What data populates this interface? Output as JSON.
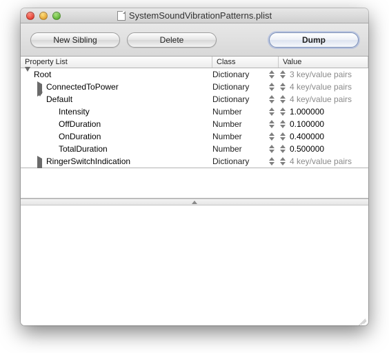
{
  "window": {
    "title": "SystemSoundVibrationPatterns.plist"
  },
  "toolbar": {
    "new_sibling_label": "New Sibling",
    "delete_label": "Delete",
    "dump_label": "Dump"
  },
  "headers": {
    "property": "Property List",
    "class": "Class",
    "value": "Value"
  },
  "rows": [
    {
      "indent": 0,
      "disclosure": "down",
      "name": "Root",
      "class": "Dictionary",
      "value": "3 key/value pairs",
      "muted": true
    },
    {
      "indent": 1,
      "disclosure": "right",
      "name": "ConnectedToPower",
      "class": "Dictionary",
      "value": "4 key/value pairs",
      "muted": true
    },
    {
      "indent": 1,
      "disclosure": "down",
      "name": "Default",
      "class": "Dictionary",
      "value": "4 key/value pairs",
      "muted": true
    },
    {
      "indent": 2,
      "disclosure": "none",
      "name": "Intensity",
      "class": "Number",
      "value": "1.000000",
      "muted": false
    },
    {
      "indent": 2,
      "disclosure": "none",
      "name": "OffDuration",
      "class": "Number",
      "value": "0.100000",
      "muted": false
    },
    {
      "indent": 2,
      "disclosure": "none",
      "name": "OnDuration",
      "class": "Number",
      "value": "0.400000",
      "muted": false
    },
    {
      "indent": 2,
      "disclosure": "none",
      "name": "TotalDuration",
      "class": "Number",
      "value": "0.500000",
      "muted": false
    },
    {
      "indent": 1,
      "disclosure": "right",
      "name": "RingerSwitchIndication",
      "class": "Dictionary",
      "value": "4 key/value pairs",
      "muted": true
    }
  ]
}
